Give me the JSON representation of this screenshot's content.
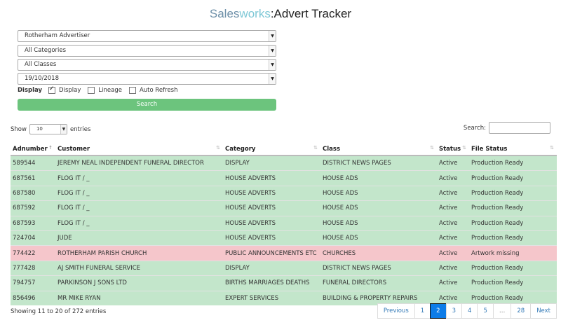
{
  "header": {
    "title_part1": "Sales",
    "title_part2": "works",
    "title_part3": ":Advert Tracker"
  },
  "filters": {
    "publication": "Rotherham Advertiser",
    "category": "All Categories",
    "class": "All Classes",
    "date": "19/10/2018",
    "display_label": "Display",
    "options": [
      {
        "label": "Display",
        "checked": true
      },
      {
        "label": "Lineage",
        "checked": false
      },
      {
        "label": "Auto Refresh",
        "checked": false
      }
    ],
    "search_button": "Search"
  },
  "table_controls": {
    "show_label": "Show",
    "entries_value": "10",
    "entries_label": "entries",
    "search_label": "Search:"
  },
  "table": {
    "columns": [
      "Adnumber",
      "Customer",
      "Category",
      "Class",
      "Status",
      "File Status"
    ],
    "rows": [
      {
        "adnumber": "589544",
        "customer": "JEREMY NEAL INDEPENDENT FUNERAL DIRECTOR",
        "category": "DISPLAY",
        "class": "DISTRICT NEWS PAGES",
        "status": "Active",
        "file_status": "Production Ready",
        "color": "#c3e6cb"
      },
      {
        "adnumber": "687561",
        "customer": "FLOG IT / _",
        "category": "HOUSE ADVERTS",
        "class": "HOUSE ADS",
        "status": "Active",
        "file_status": "Production Ready",
        "color": "#c3e6cb"
      },
      {
        "adnumber": "687580",
        "customer": "FLOG IT / _",
        "category": "HOUSE ADVERTS",
        "class": "HOUSE ADS",
        "status": "Active",
        "file_status": "Production Ready",
        "color": "#c3e6cb"
      },
      {
        "adnumber": "687592",
        "customer": "FLOG IT / _",
        "category": "HOUSE ADVERTS",
        "class": "HOUSE ADS",
        "status": "Active",
        "file_status": "Production Ready",
        "color": "#c3e6cb"
      },
      {
        "adnumber": "687593",
        "customer": "FLOG IT / _",
        "category": "HOUSE ADVERTS",
        "class": "HOUSE ADS",
        "status": "Active",
        "file_status": "Production Ready",
        "color": "#c3e6cb"
      },
      {
        "adnumber": "724704",
        "customer": "JUDE",
        "category": "HOUSE ADVERTS",
        "class": "HOUSE ADS",
        "status": "Active",
        "file_status": "Production Ready",
        "color": "#c3e6cb"
      },
      {
        "adnumber": "774422",
        "customer": "ROTHERHAM PARISH CHURCH",
        "category": "PUBLIC ANNOUNCEMENTS ETC",
        "class": "CHURCHES",
        "status": "Active",
        "file_status": "Artwork missing",
        "color": "#f5c6cb"
      },
      {
        "adnumber": "777428",
        "customer": "AJ SMITH FUNERAL SERVICE",
        "category": "DISPLAY",
        "class": "DISTRICT NEWS PAGES",
        "status": "Active",
        "file_status": "Production Ready",
        "color": "#c3e6cb"
      },
      {
        "adnumber": "794757",
        "customer": "PARKINSON J SONS LTD",
        "category": "BIRTHS MARRIAGES DEATHS",
        "class": "FUNERAL DIRECTORS",
        "status": "Active",
        "file_status": "Production Ready",
        "color": "#c3e6cb"
      },
      {
        "adnumber": "856496",
        "customer": "MR MIKE RYAN",
        "category": "EXPERT SERVICES",
        "class": "BUILDING & PROPERTY REPAIRS",
        "status": "Active",
        "file_status": "Production Ready",
        "color": "#c3e6cb"
      }
    ]
  },
  "footer": {
    "info": "Showing 11 to 20 of 272 entries",
    "pagination": [
      "Previous",
      "1",
      "2",
      "3",
      "4",
      "5",
      "…",
      "28",
      "Next"
    ],
    "active_page": "2"
  },
  "colors": {
    "row_ok": "#c3e6cb",
    "row_error": "#f5c6cb",
    "search_button": "#6cc47d",
    "active_page": "#0d7ce8"
  }
}
